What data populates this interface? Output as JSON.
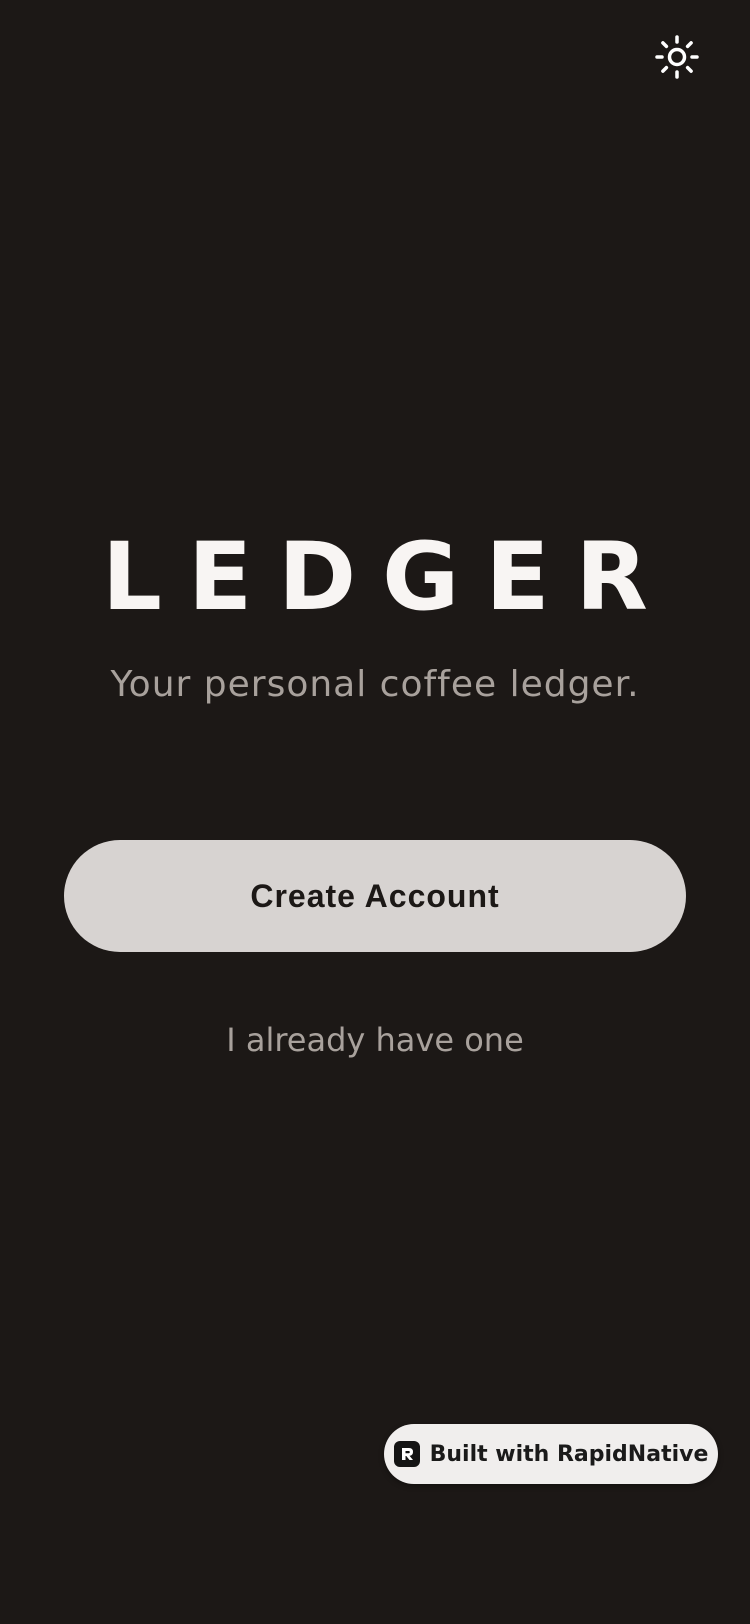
{
  "header": {
    "theme_toggle_icon": "sun-icon"
  },
  "brand": {
    "title": "LEDGER",
    "tagline": "Your personal coffee ledger."
  },
  "actions": {
    "create_account_label": "Create Account",
    "login_label": "I already have one"
  },
  "badge": {
    "logo_icon": "rapidnative-logo-icon",
    "label": "Built with RapidNative"
  },
  "colors": {
    "background": "#1c1816",
    "title": "#f8f5f3",
    "muted_text": "#a8a19c",
    "primary_button": "#d7d3d1",
    "primary_button_text": "#1c1816",
    "badge_background": "#f0eeed"
  }
}
